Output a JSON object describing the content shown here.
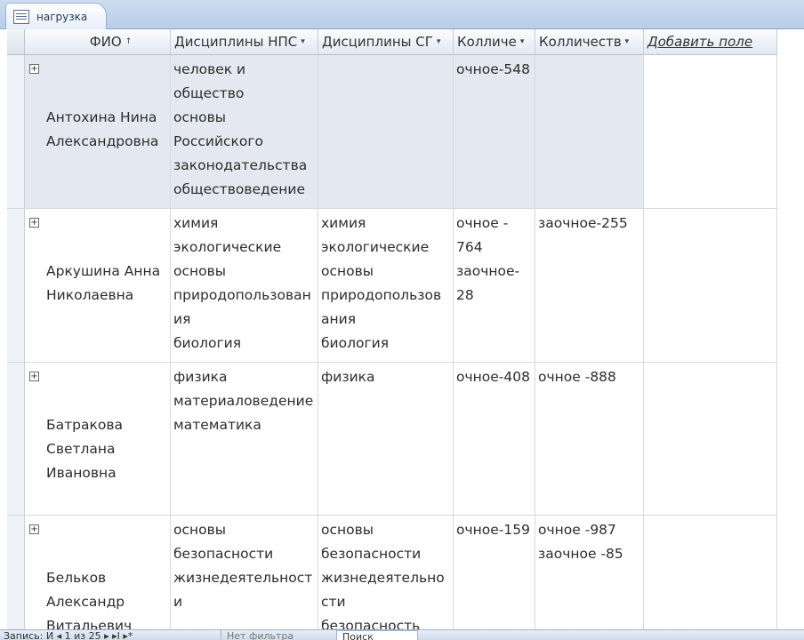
{
  "window": {
    "tab_title": "нагрузка"
  },
  "columns": [
    {
      "label": "ФИО",
      "arrow": "↑"
    },
    {
      "label": "Дисциплины НПС",
      "arrow": "▾"
    },
    {
      "label": "Дисциплины СГ",
      "arrow": "▾"
    },
    {
      "label": "Колличе",
      "arrow": "▾"
    },
    {
      "label": "Колличеств",
      "arrow": "▾"
    },
    {
      "label": "Добавить поле",
      "arrow": ""
    }
  ],
  "rows": [
    {
      "fio": "Антохина Нина\nАлександровна",
      "npc": "человек и\nобщество\nосновы\nРоссийского\nзаконодательства\nобществоведение",
      "sg": "",
      "k1": "очное-548",
      "k2": ""
    },
    {
      "fio": "Аркушина Анна\n Николаевна",
      "npc": "химия\nэкологические\nосновы\nприродопользован\nия\nбиология",
      "sg": "химия\nэкологические\nосновы\nприродопользов\nания\nбиология",
      "k1": "очное -\n764\nзаочное-\n28",
      "k2": "заочное-255"
    },
    {
      "fio": "Батракова\nСветлана\nИвановна",
      "npc": "физика\nматериаловедение\nматематика",
      "sg": "физика",
      "k1": "очное-408",
      "k2": "очное -888"
    },
    {
      "fio": "Бельков\nАлександр\nВитальевич",
      "npc": "основы\nбезопасности\nжизнедеятельност\nи",
      "sg": "основы\nбезопасности\nжизнедеятельно\nсти\nбезопасность",
      "k1": "очное-159",
      "k2": "очное -987\nзаочное -85"
    }
  ],
  "status": {
    "nav": "Запись: И  ◂ 1 из 25  ▸ ▸I ▸*",
    "filter": "Нет фильтра",
    "search": "Поиск"
  }
}
